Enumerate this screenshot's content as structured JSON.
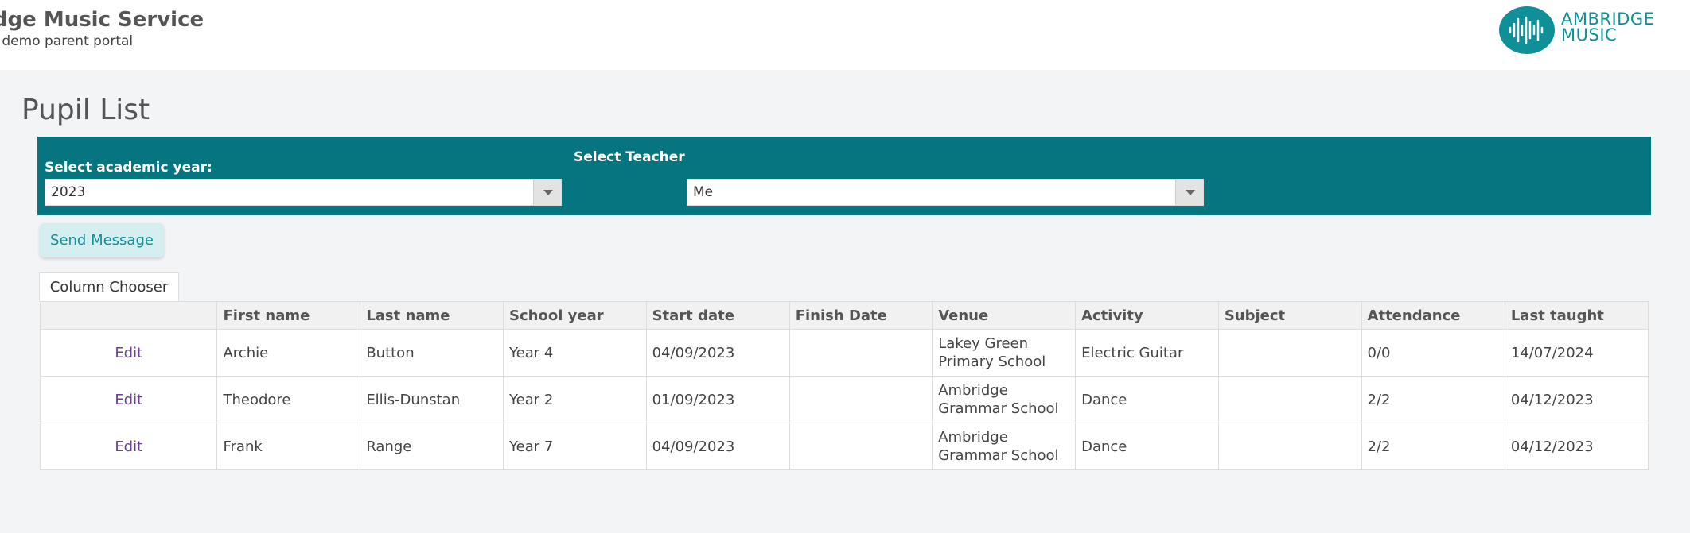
{
  "header": {
    "title": "idge Music Service",
    "subtitle": "r demo parent portal",
    "logo_text_line1": "AMBRIDGE",
    "logo_text_line2": "MUSIC"
  },
  "page": {
    "title": "Pupil List"
  },
  "filters": {
    "year_label": "Select academic year:",
    "year_value": "2023",
    "teacher_label": "Select Teacher",
    "teacher_value": "Me"
  },
  "actions": {
    "send_message": "Send Message",
    "column_chooser": "Column Chooser"
  },
  "table": {
    "columns": [
      "",
      "First name",
      "Last name",
      "School year",
      "Start date",
      "Finish Date",
      "Venue",
      "Activity",
      "Subject",
      "Attendance",
      "Last taught"
    ],
    "rows": [
      {
        "action": "Edit",
        "first": "Archie",
        "last": "Button",
        "year": "Year 4",
        "start": "04/09/2023",
        "finish": "",
        "venue": "Lakey Green Primary School",
        "activity": "Electric Guitar",
        "subject": "",
        "attendance": "0/0",
        "last_taught": "14/07/2024"
      },
      {
        "action": "Edit",
        "first": "Theodore",
        "last": "Ellis-Dunstan",
        "year": "Year 2",
        "start": "01/09/2023",
        "finish": "",
        "venue": "Ambridge Grammar School",
        "activity": "Dance",
        "subject": "",
        "attendance": "2/2",
        "last_taught": "04/12/2023"
      },
      {
        "action": "Edit",
        "first": "Frank",
        "last": "Range",
        "year": "Year 7",
        "start": "04/09/2023",
        "finish": "",
        "venue": "Ambridge Grammar School",
        "activity": "Dance",
        "subject": "",
        "attendance": "2/2",
        "last_taught": "04/12/2023"
      }
    ]
  },
  "colors": {
    "accent": "#077580",
    "brand": "#0f8f97",
    "edit_link": "#6d3f8f"
  }
}
